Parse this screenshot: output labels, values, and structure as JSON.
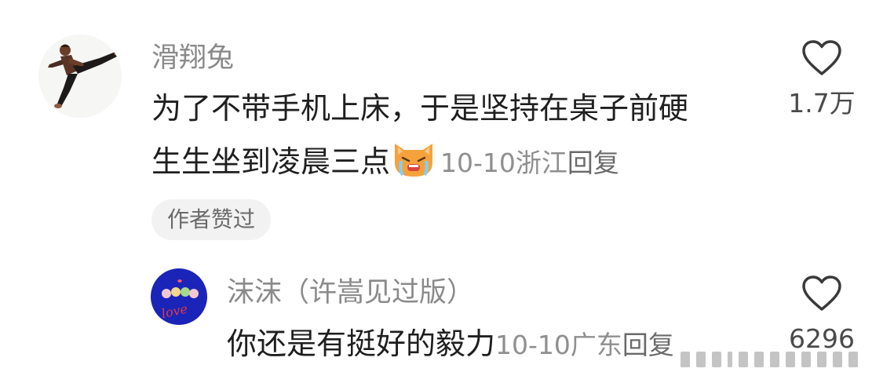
{
  "comments": [
    {
      "username": "滑翔兔",
      "text_line1": "为了不带手机上床，于是坚持在桌子前硬",
      "text_line2": "生生坐到凌晨三点",
      "emoji": "crying-cat-emoji",
      "date": "10-10",
      "location": "浙江",
      "reply_label": "回复",
      "likes": "1.7万",
      "badge": "作者赞过"
    },
    {
      "username": "沫沫（许嵩见过版）",
      "text": "你还是有挺好的毅力",
      "date": "10-10",
      "location": "广东",
      "reply_label": "回复",
      "likes": "6296"
    }
  ],
  "avatar_text": "love",
  "colors": {
    "username": "#8a8a8a",
    "text": "#1f1f1f",
    "meta": "#8f8f8f",
    "badge_bg": "#f2f2f2",
    "avatar2_bg": "#1b24b8"
  }
}
